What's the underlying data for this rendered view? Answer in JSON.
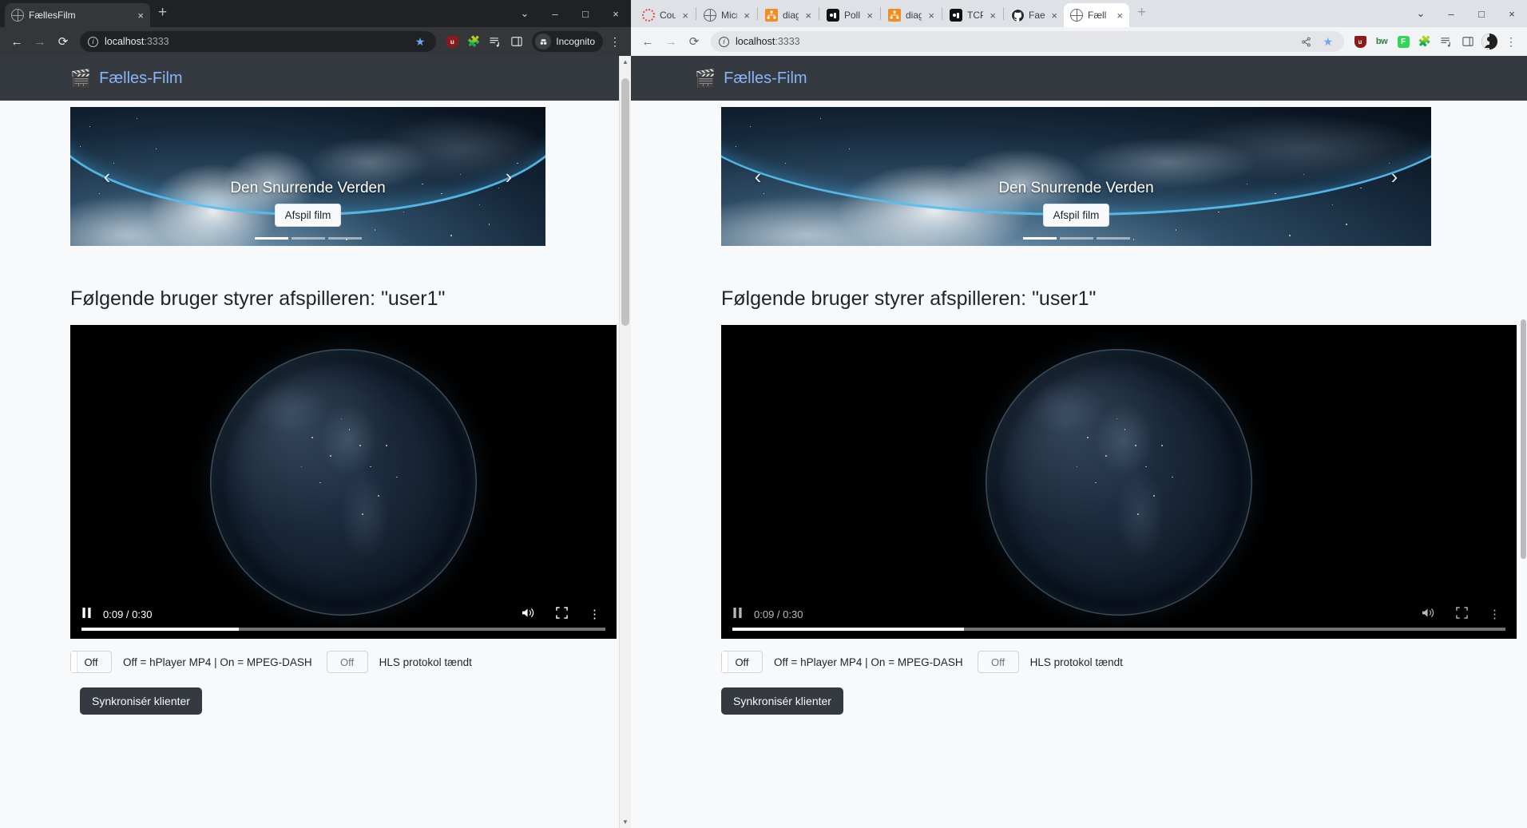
{
  "left_window": {
    "tabs": [
      {
        "label": "FællesFilm",
        "icon": "globe-icon",
        "active": true,
        "close": "×"
      }
    ],
    "new_tab": "+",
    "window_controls": {
      "list": "⌄",
      "minimize": "–",
      "maximize": "□",
      "close": "×"
    },
    "toolbar": {
      "back": "←",
      "forward": "→",
      "reload": "⟳",
      "info_icon": "info-icon",
      "url_host": "localhost",
      "url_port": ":3333",
      "star_icon": "bookmark-star-icon",
      "extensions": [
        "ublock-origin-icon",
        "puzzle-extensions-icon",
        "reading-list-icon",
        "side-panel-icon"
      ],
      "profile_label": "Incognito",
      "menu": "⋮"
    }
  },
  "right_window": {
    "tabs": [
      {
        "label": "Cou",
        "icon": "red-ring-icon",
        "active": false,
        "close": "×"
      },
      {
        "label": "Micr",
        "icon": "globe-icon",
        "active": false,
        "close": "×"
      },
      {
        "label": "diag",
        "icon": "orange-diagram-icon",
        "active": false,
        "close": "×"
      },
      {
        "label": "Polli",
        "icon": "dark-badge-icon",
        "active": false,
        "close": "×"
      },
      {
        "label": "diag",
        "icon": "orange-diagram-icon",
        "active": false,
        "close": "×"
      },
      {
        "label": "TCP",
        "icon": "dark-badge-icon",
        "active": false,
        "close": "×"
      },
      {
        "label": "Fael",
        "icon": "github-icon",
        "active": false,
        "close": "×"
      },
      {
        "label": "Fæll",
        "icon": "globe-icon",
        "active": true,
        "close": "×"
      }
    ],
    "new_tab": "+",
    "window_controls": {
      "list": "⌄",
      "minimize": "–",
      "maximize": "□",
      "close": "×"
    },
    "toolbar": {
      "back": "←",
      "forward": "→",
      "reload": "⟳",
      "info_icon": "info-icon",
      "url_host": "localhost",
      "url_port": ":3333",
      "share_icon": "share-icon",
      "star_icon": "bookmark-star-icon",
      "extensions": [
        "ublock-origin-icon",
        "bitwarden-icon",
        "grammarly-icon",
        "puzzle-extensions-icon",
        "reading-list-icon",
        "side-panel-icon"
      ],
      "avatar": "profile-avatar",
      "menu": "⋮"
    }
  },
  "app": {
    "brand": "Fælles-Film",
    "brand_logo": "clapperboard-popcorn-icon",
    "carousel": {
      "prev": "‹",
      "next": "›",
      "slide_title": "Den Snurrende Verden",
      "button": "Afspil film",
      "indicator_count": 3,
      "active_indicator": 0
    },
    "player_heading": "Følgende bruger styrer afspilleren: \"user1\"",
    "video": {
      "play_pause": "pause-icon",
      "time": "0:09 / 0:30",
      "current_time": "0:09",
      "duration": "0:30",
      "progress_percent": 30,
      "volume_icon": "volume-icon",
      "fullscreen_icon": "fullscreen-icon",
      "more_icon": "more-options-icon"
    },
    "controls": {
      "dash_toggle_label": "Off",
      "dash_description": "Off = hPlayer MP4 | On = MPEG-DASH",
      "hls_toggle_label": "Off",
      "hls_description": "HLS protokol tændt",
      "sync_button": "Synkronisér klienter"
    }
  },
  "colors": {
    "appbar": "#343a40",
    "brand_text": "#8ab4f8",
    "page_bg": "#f8f9fa",
    "sync_button_bg": "#343a40",
    "dark_chrome": "#202124",
    "light_chrome": "#dee1e6"
  }
}
